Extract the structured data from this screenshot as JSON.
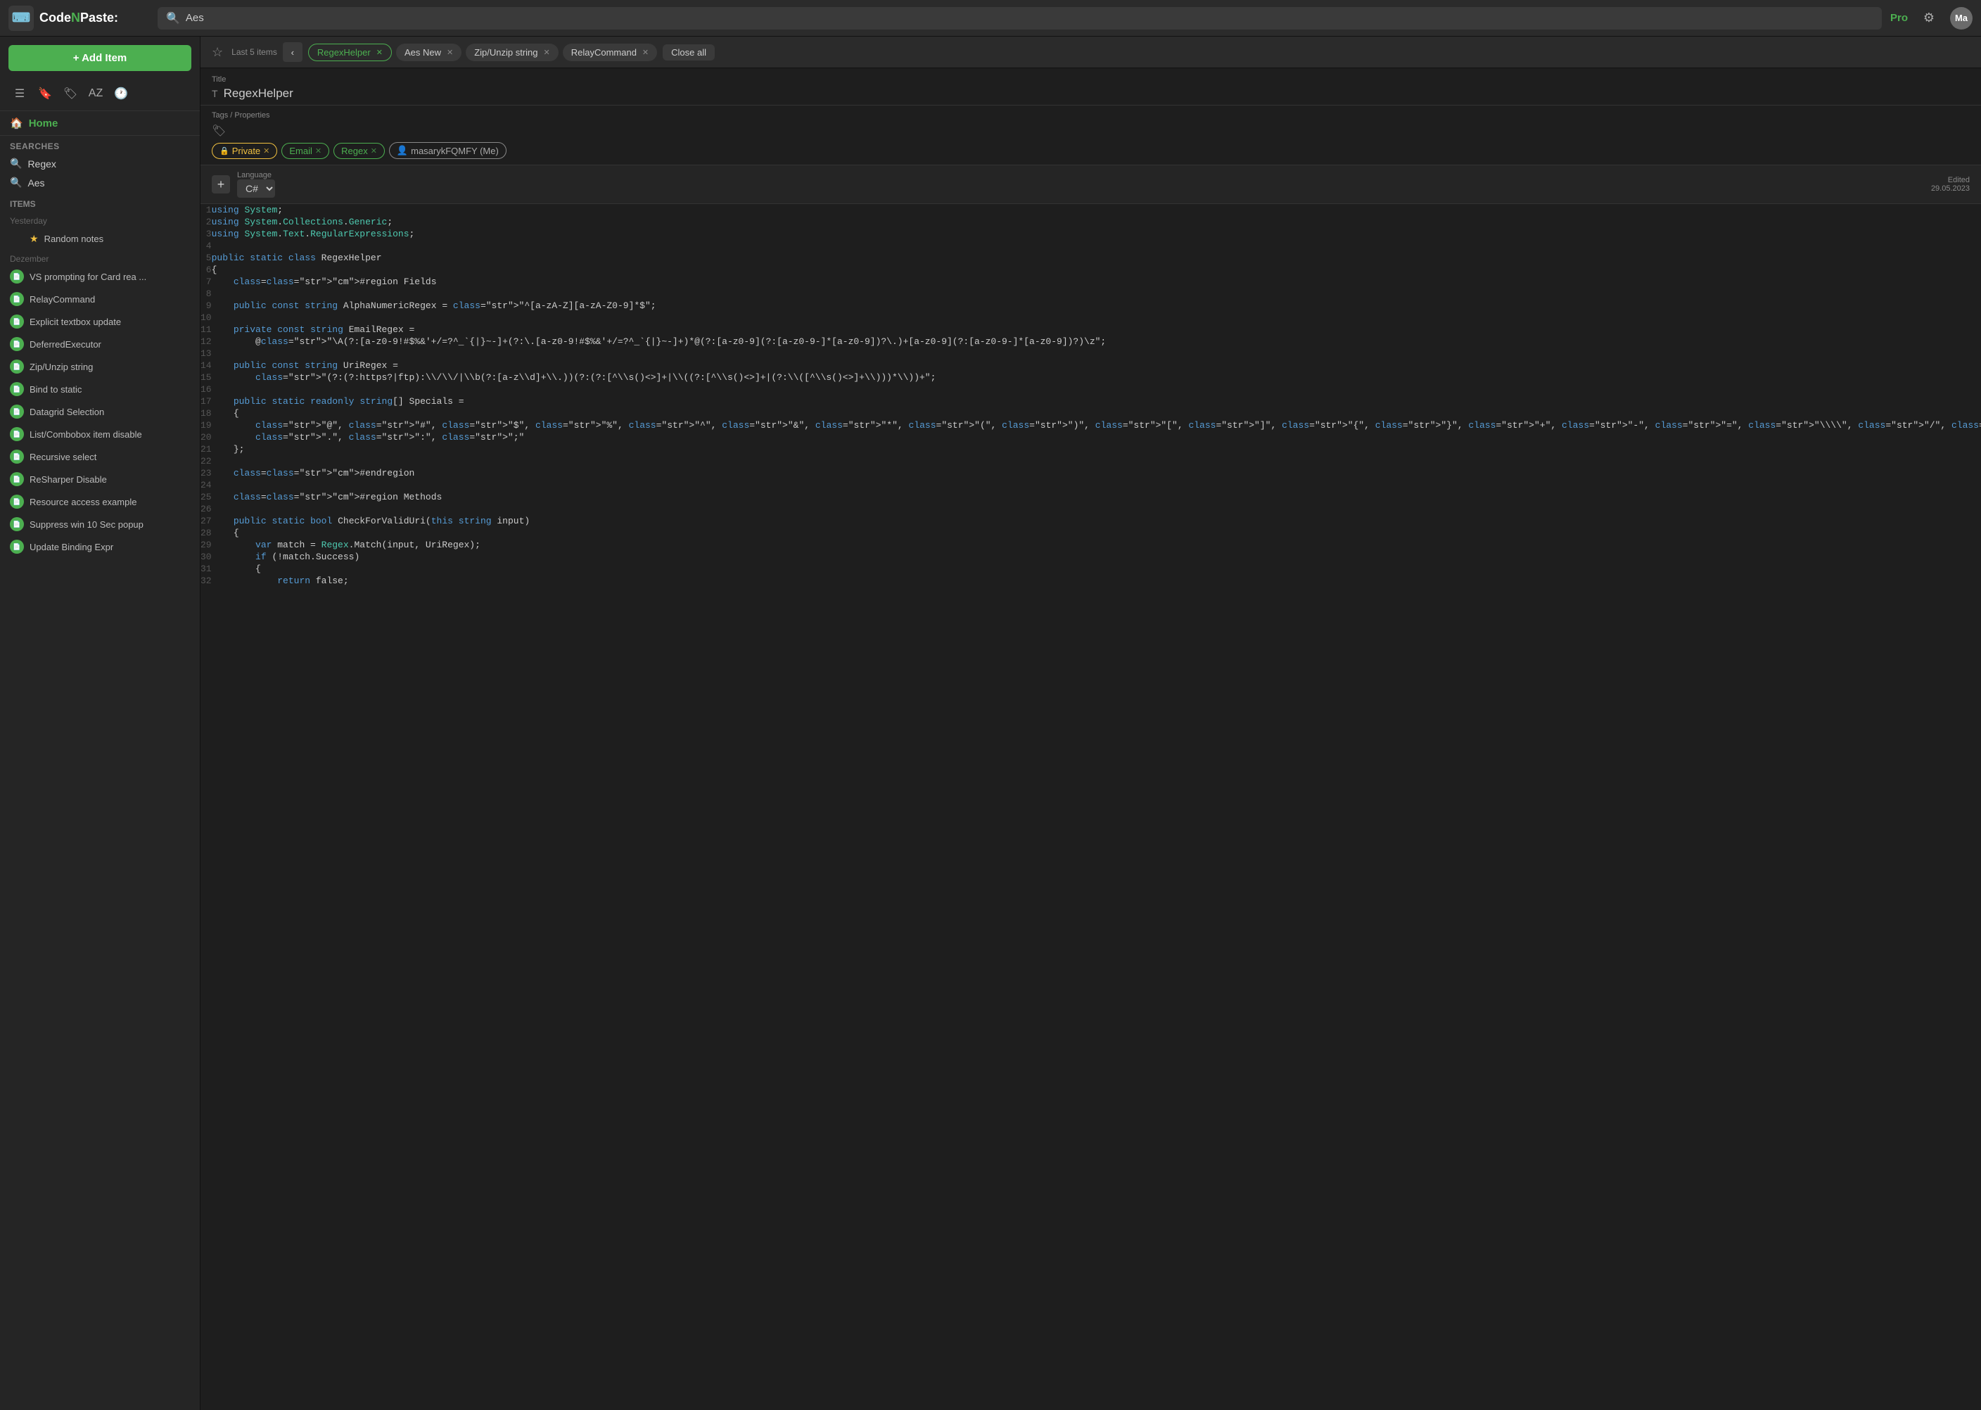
{
  "topbar": {
    "logo_text1": "Code",
    "logo_text2": "N",
    "logo_text3": "Paste:",
    "search_placeholder": "Aes",
    "search_value": "Aes",
    "pro_label": "Pro",
    "avatar_initials": "Ma"
  },
  "sidebar": {
    "add_item_label": "+ Add Item",
    "home_label": "Home",
    "searches_label": "Searches",
    "searches": [
      {
        "text": "Regex"
      },
      {
        "text": "Aes"
      }
    ],
    "items_label": "Items",
    "groups": [
      {
        "label": "Yesterday",
        "items": [
          {
            "text": "Random notes",
            "starred": true
          }
        ]
      },
      {
        "label": "Dezember",
        "items": [
          {
            "text": "VS prompting for Card rea ...",
            "starred": false
          },
          {
            "text": "RelayCommand",
            "starred": false
          },
          {
            "text": "Explicit textbox update",
            "starred": false
          },
          {
            "text": "DeferredExecutor",
            "starred": false
          },
          {
            "text": "Zip/Unzip string",
            "starred": false
          },
          {
            "text": "Bind to static",
            "starred": false
          },
          {
            "text": "Datagrid Selection",
            "starred": false
          },
          {
            "text": "List/Combobox item disable",
            "starred": false
          },
          {
            "text": "Recursive select",
            "starred": false
          },
          {
            "text": "ReSharper Disable",
            "starred": false
          },
          {
            "text": "Resource access example",
            "starred": false
          },
          {
            "text": "Suppress win 10 Sec popup",
            "starred": false
          },
          {
            "text": "Update Binding Expr",
            "starred": false
          }
        ]
      }
    ]
  },
  "tabs": {
    "last5_label": "Last 5 items",
    "items": [
      {
        "label": "RegexHelper",
        "active": true
      },
      {
        "label": "Aes New",
        "active": false
      },
      {
        "label": "Zip/Unzip string",
        "active": false
      },
      {
        "label": "RelayCommand",
        "active": false
      }
    ],
    "close_all_label": "Close all"
  },
  "title_section": {
    "label": "Title",
    "value": "RegexHelper"
  },
  "tags_section": {
    "label": "Tags / Properties",
    "tags": [
      {
        "type": "private",
        "label": "Private"
      },
      {
        "type": "email",
        "label": "Email"
      },
      {
        "type": "regex",
        "label": "Regex"
      },
      {
        "type": "user",
        "label": "masarykFQMFY (Me)"
      }
    ]
  },
  "editor": {
    "add_snippet_label": "+",
    "language_label": "Language",
    "language_value": "C#",
    "edited_label": "Edited",
    "edited_date": "29.05.2023",
    "lines": [
      {
        "num": 1,
        "code": "using System;"
      },
      {
        "num": 2,
        "code": "using System.Collections.Generic;"
      },
      {
        "num": 3,
        "code": "using System.Text.RegularExpressions;"
      },
      {
        "num": 4,
        "code": ""
      },
      {
        "num": 5,
        "code": "public static class RegexHelper"
      },
      {
        "num": 6,
        "code": "{"
      },
      {
        "num": 7,
        "code": "    #region Fields"
      },
      {
        "num": 8,
        "code": ""
      },
      {
        "num": 9,
        "code": "    public const string AlphaNumericRegex = \"^[a-zA-Z][a-zA-Z0-9]*$\";"
      },
      {
        "num": 10,
        "code": ""
      },
      {
        "num": 11,
        "code": "    private const string EmailRegex ="
      },
      {
        "num": 12,
        "code": "        @\"\\A(?:[a-z0-9!#$%&'+/=?^_`{|}~-]+(?:\\.[a-z0-9!#$%&'+/=?^_`{|}~-]+)*@(?:[a-z0-9](?:[a-z0-9-]*[a-z0-9])?\\.)+[a-z0-9](?:[a-z0-9-]*[a-z0-9])?)\\z\";"
      },
      {
        "num": 13,
        "code": ""
      },
      {
        "num": 14,
        "code": "    public const string UriRegex ="
      },
      {
        "num": 15,
        "code": "        \"(?:(?:https?|ftp):\\\\/\\\\/|\\\\b(?:[a-z\\\\d]+\\\\.))(?:(?:[^\\\\s()<>]+|\\\\((?:[^\\\\s()<>]+|(?:\\\\([^\\\\s()<>]+\\\\)))*\\\\))+\";"
      },
      {
        "num": 16,
        "code": ""
      },
      {
        "num": 17,
        "code": "    public static readonly string[] Specials ="
      },
      {
        "num": 18,
        "code": "    {"
      },
      {
        "num": 19,
        "code": "        \"@\", \"#\", \"$\", \"%\", \"^\", \"&\", \"*\", \"(\", \")\", \"[\", \"]\", \"{\", \"}\", \"+\", \"-\", \"=\", \"\\\\\\\\\", \"/\", \"?\", \",\","
      },
      {
        "num": 20,
        "code": "        \".\", \":\", \";\""
      },
      {
        "num": 21,
        "code": "    };"
      },
      {
        "num": 22,
        "code": ""
      },
      {
        "num": 23,
        "code": "    #endregion"
      },
      {
        "num": 24,
        "code": ""
      },
      {
        "num": 25,
        "code": "    #region Methods"
      },
      {
        "num": 26,
        "code": ""
      },
      {
        "num": 27,
        "code": "    public static bool CheckForValidUri(this string input)"
      },
      {
        "num": 28,
        "code": "    {"
      },
      {
        "num": 29,
        "code": "        var match = Regex.Match(input, UriRegex);"
      },
      {
        "num": 30,
        "code": "        if (!match.Success)"
      },
      {
        "num": 31,
        "code": "        {"
      },
      {
        "num": 32,
        "code": "            return false;"
      }
    ]
  }
}
